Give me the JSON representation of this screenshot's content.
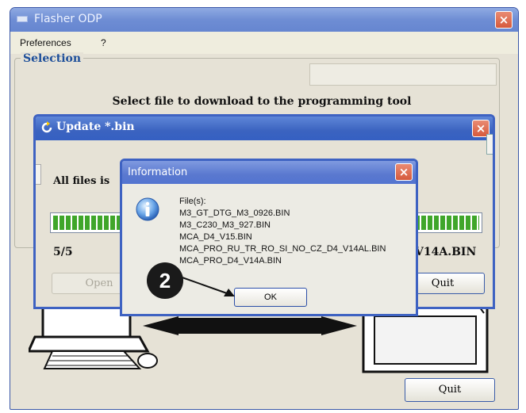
{
  "main_window": {
    "title": "Flasher ODP",
    "close_glyph": "×",
    "menu": [
      "Preferences",
      "?"
    ],
    "selection_label": "Selection",
    "instruction": "Select file to download to the programming tool",
    "quit_label": "Quit"
  },
  "update_dialog": {
    "title": "Update *.bin",
    "message": "All files is",
    "progress_count": "5/5",
    "progress_fraction": 1.0,
    "current_file_fragment": "V14A.BIN",
    "open_label": "Open",
    "quit_label": "Quit"
  },
  "info_dialog": {
    "title": "Information",
    "files_heading": "File(s):",
    "files": [
      "M3_GT_DTG_M3_0926.BIN",
      "M3_C230_M3_927.BIN",
      "MCA_D4_V15.BIN",
      "MCA_PRO_RU_TR_RO_SI_NO_CZ_D4_V14AL.BIN",
      "MCA_PRO_D4_V14A.BIN"
    ],
    "ok_label": "OK"
  },
  "callout": {
    "number": "2"
  },
  "colors": {
    "titlebar_active": "#3b63c0",
    "titlebar_inactive": "#7f9ae0",
    "close_button": "#d65a3c",
    "progress_fill": "#3fa62a",
    "selection_label": "#1e4f9a"
  },
  "icons": {
    "app": "window-icon",
    "update": "refresh-icon",
    "info": "info-icon",
    "close": "close-icon"
  }
}
